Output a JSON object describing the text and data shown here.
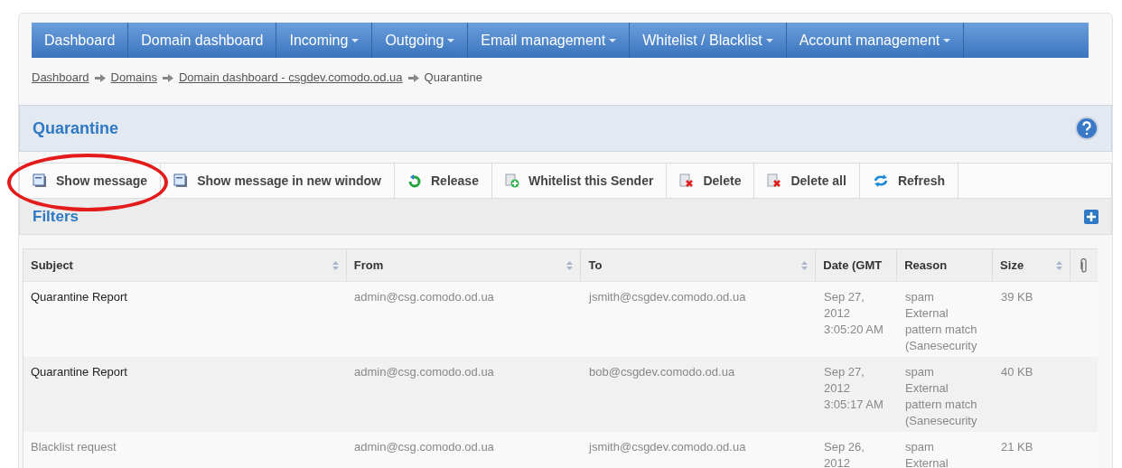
{
  "nav": [
    {
      "label": "Dashboard",
      "dropdown": false
    },
    {
      "label": "Domain dashboard",
      "dropdown": false
    },
    {
      "label": "Incoming",
      "dropdown": true
    },
    {
      "label": "Outgoing",
      "dropdown": true
    },
    {
      "label": "Email management",
      "dropdown": true
    },
    {
      "label": "Whitelist / Blacklist",
      "dropdown": true
    },
    {
      "label": "Account management",
      "dropdown": true
    }
  ],
  "breadcrumb": [
    {
      "label": "Dashboard",
      "link": true
    },
    {
      "label": "Domains",
      "link": true
    },
    {
      "label": "Domain dashboard - csgdev.comodo.od.ua",
      "link": true
    },
    {
      "label": "Quarantine",
      "link": false
    }
  ],
  "panel_title": "Quarantine",
  "toolbar": [
    {
      "label": "Show message",
      "kind": "message"
    },
    {
      "label": "Show message in new window",
      "kind": "message"
    },
    {
      "label": "Release",
      "kind": "release"
    },
    {
      "label": "Whitelist this Sender",
      "kind": "whitelist"
    },
    {
      "label": "Delete",
      "kind": "delete"
    },
    {
      "label": "Delete all",
      "kind": "delete"
    },
    {
      "label": "Refresh",
      "kind": "refresh"
    }
  ],
  "filters_title": "Filters",
  "table": {
    "columns": [
      {
        "label": "Subject",
        "sortable": true
      },
      {
        "label": "From",
        "sortable": true
      },
      {
        "label": "To",
        "sortable": true
      },
      {
        "label": "Date (GMT",
        "sortable": false
      },
      {
        "label": "Reason",
        "sortable": false
      },
      {
        "label": "Size",
        "sortable": true
      }
    ],
    "rows": [
      {
        "unread": true,
        "cells": [
          "Quarantine Report",
          "admin@csg.comodo.od.ua",
          "jsmith@csgdev.comodo.od.ua",
          "Sep 27,\n2012\n3:05:20 AM",
          "spam\nExternal\npattern match\n(Sanesecurity",
          "39 KB"
        ]
      },
      {
        "unread": true,
        "cells": [
          "Quarantine Report",
          "admin@csg.comodo.od.ua",
          "bob@csgdev.comodo.od.ua",
          "Sep 27,\n2012\n3:05:17 AM",
          "spam\nExternal\npattern match\n(Sanesecurity",
          "40 KB"
        ]
      },
      {
        "unread": false,
        "cells": [
          "Blacklist request",
          "admin@csg.comodo.od.ua",
          "jsmith@csgdev.comodo.od.ua",
          "Sep 26,\n2012",
          "spam\nExternal",
          "21 KB"
        ]
      }
    ]
  }
}
